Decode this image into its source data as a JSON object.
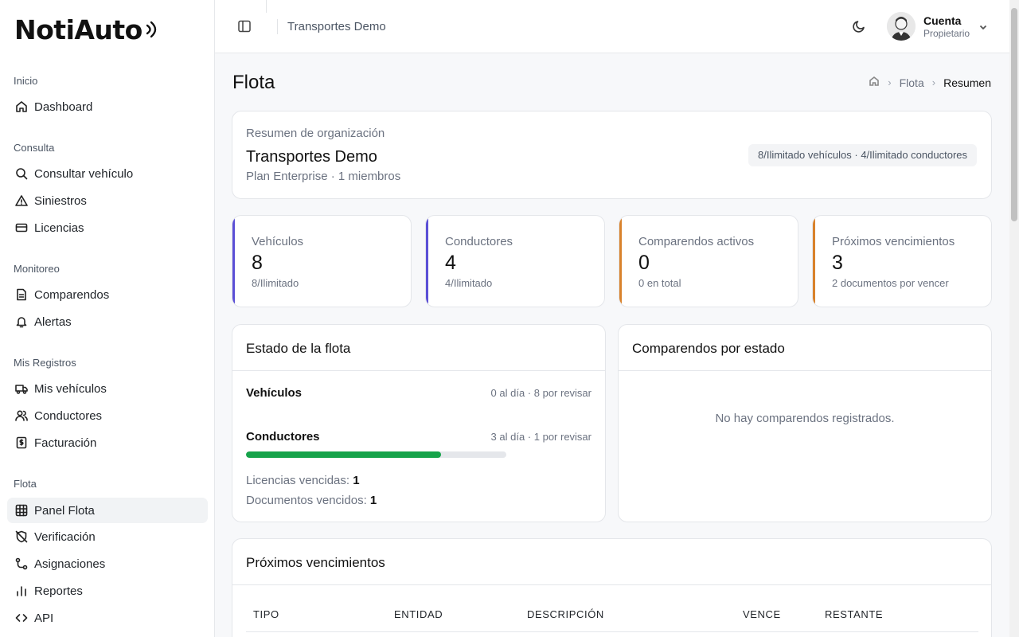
{
  "brand": {
    "logo_text": "NotiAuto"
  },
  "sidebar": {
    "sections": [
      {
        "title": "Inicio",
        "items": [
          {
            "label": "Dashboard",
            "icon": "home-icon"
          }
        ]
      },
      {
        "title": "Consulta",
        "items": [
          {
            "label": "Consultar vehículo",
            "icon": "search-icon"
          },
          {
            "label": "Siniestros",
            "icon": "warning-icon"
          },
          {
            "label": "Licencias",
            "icon": "card-icon"
          }
        ]
      },
      {
        "title": "Monitoreo",
        "items": [
          {
            "label": "Comparendos",
            "icon": "document-icon"
          },
          {
            "label": "Alertas",
            "icon": "bell-icon"
          }
        ]
      },
      {
        "title": "Mis Registros",
        "items": [
          {
            "label": "Mis vehículos",
            "icon": "truck-icon"
          },
          {
            "label": "Conductores",
            "icon": "users-icon"
          },
          {
            "label": "Facturación",
            "icon": "receipt-icon"
          }
        ]
      },
      {
        "title": "Flota",
        "items": [
          {
            "label": "Panel Flota",
            "icon": "grid-icon",
            "active": true
          },
          {
            "label": "Verificación",
            "icon": "shield-off-icon"
          },
          {
            "label": "Asignaciones",
            "icon": "route-icon"
          },
          {
            "label": "Reportes",
            "icon": "bar-chart-icon"
          },
          {
            "label": "API",
            "icon": "code-icon"
          }
        ]
      }
    ]
  },
  "header": {
    "org_name": "Transportes Demo",
    "account_name": "Cuenta",
    "account_role": "Propietario"
  },
  "page": {
    "title": "Flota",
    "breadcrumb": [
      "Flota",
      "Resumen"
    ]
  },
  "org_summary": {
    "label": "Resumen de organización",
    "name": "Transportes Demo",
    "plan": "Plan Enterprise · 1 miembros",
    "limits": "8/Ilimitado vehículos · 4/Ilimitado conductores"
  },
  "stats": [
    {
      "label": "Vehículos",
      "value": "8",
      "sub": "8/Ilimitado",
      "accent": "#5b4fd6"
    },
    {
      "label": "Conductores",
      "value": "4",
      "sub": "4/Ilimitado",
      "accent": "#5b4fd6"
    },
    {
      "label": "Comparendos activos",
      "value": "0",
      "sub": "0 en total",
      "accent": "#d9822b"
    },
    {
      "label": "Próximos vencimientos",
      "value": "3",
      "sub": "2 documentos por vencer",
      "accent": "#d9822b"
    }
  ],
  "fleet_status": {
    "title": "Estado de la flota",
    "vehicles_label": "Vehículos",
    "vehicles_meta": "0 al día · 8 por revisar",
    "drivers_label": "Conductores",
    "drivers_meta": "3 al día · 1 por revisar",
    "drivers_progress_pct": 75,
    "expired_licenses_label": "Licencias vencidas:",
    "expired_licenses": "1",
    "expired_docs_label": "Documentos vencidos:",
    "expired_docs": "1"
  },
  "comparendos": {
    "title": "Comparendos por estado",
    "empty": "No hay comparendos registrados."
  },
  "due": {
    "title": "Próximos vencimientos",
    "columns": [
      "TIPO",
      "ENTIDAD",
      "DESCRIPCIÓN",
      "VENCE",
      "RESTANTE"
    ]
  },
  "colors": {
    "accent_primary": "#5b4fd6",
    "accent_warning": "#d9822b",
    "success": "#16a34a"
  }
}
